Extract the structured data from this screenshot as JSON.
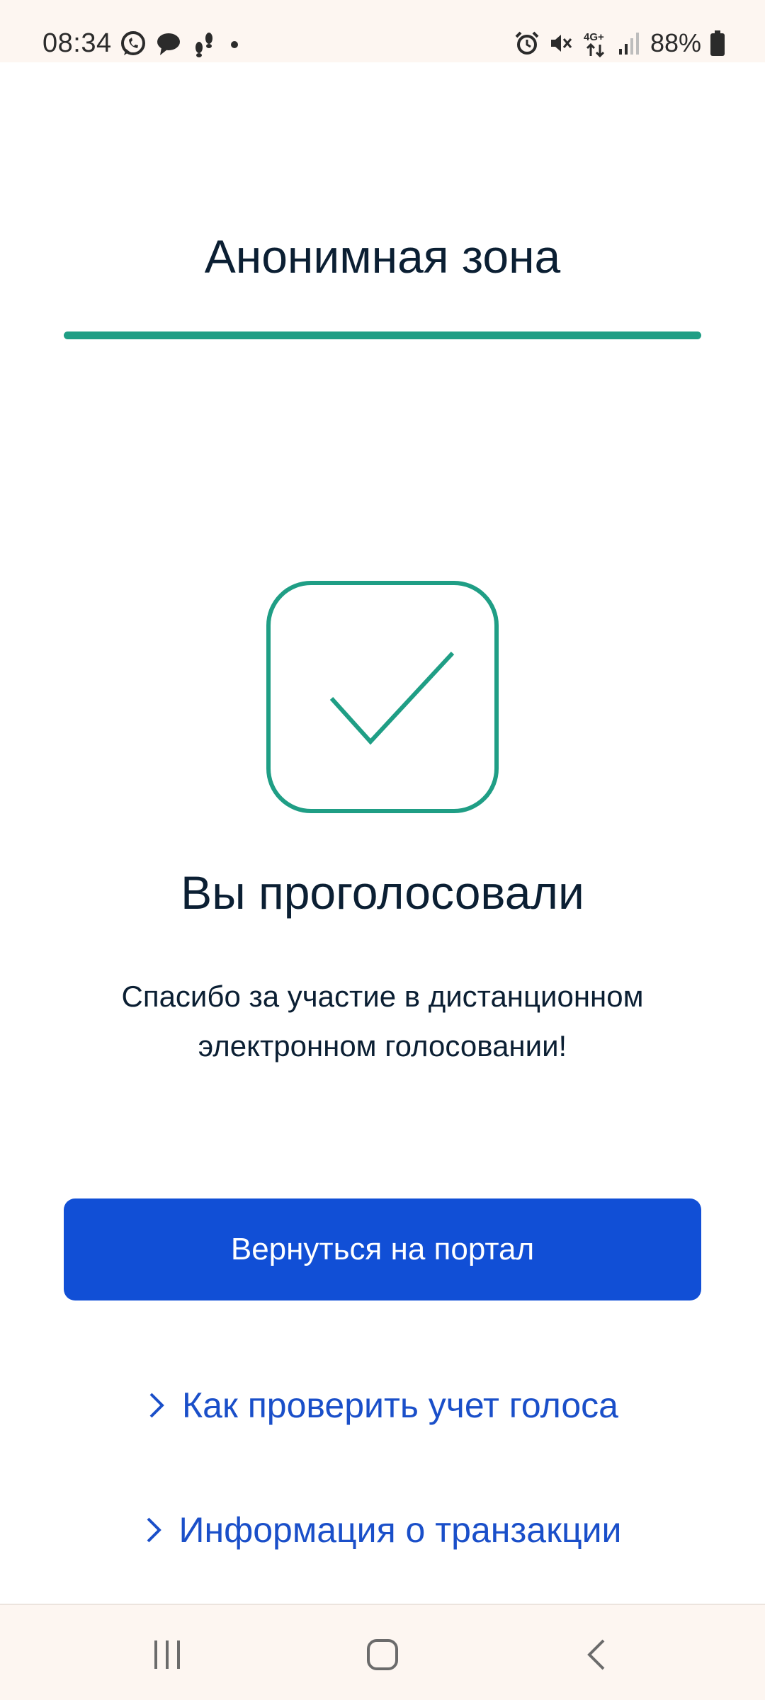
{
  "status_bar": {
    "time": "08:34",
    "left_icons": [
      "whatsapp-icon",
      "chat-bubble-icon",
      "steps-icon",
      "dot-icon"
    ],
    "right_icons": [
      "alarm-icon",
      "mute-icon",
      "network-4g-plus-icon",
      "signal-icon",
      "battery-icon"
    ],
    "network_label": "4G+",
    "battery": "88%"
  },
  "header": {
    "title": "Анонимная зона",
    "progress": 1.0,
    "accent_color": "#1f9e85"
  },
  "result": {
    "icon": "checkmark-icon",
    "title": "Вы проголосовали",
    "message": "Спасибо за участие в дистанционном электронном голосовании!"
  },
  "actions": {
    "primary_label": "Вернуться на портал",
    "primary_color": "#114fd6",
    "links": [
      {
        "label": "Как проверить учет голоса",
        "icon": "chevron-right-icon"
      },
      {
        "label": "Информация о транзакции",
        "icon": "chevron-right-icon"
      }
    ],
    "link_color": "#1a4fc9"
  },
  "nav_bar": {
    "buttons": [
      "recent-apps-icon",
      "home-icon",
      "back-icon"
    ]
  }
}
